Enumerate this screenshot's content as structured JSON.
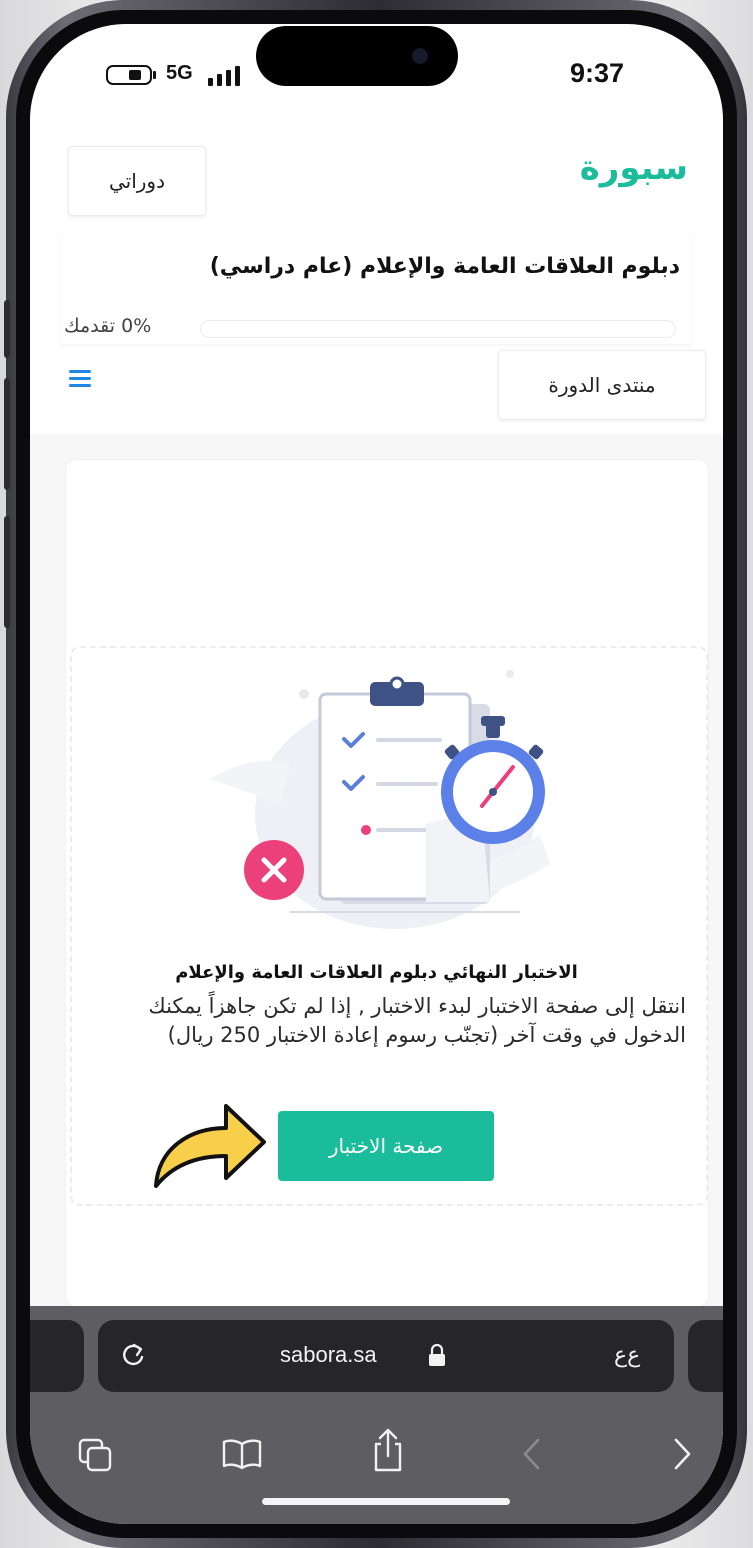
{
  "status_bar": {
    "network": "5G",
    "time": "9:37"
  },
  "header": {
    "logo": "سبورة",
    "my_courses_button": "دوراتي"
  },
  "course": {
    "title": "دبلوم العلاقات العامة والإعلام (عام دراسي)",
    "progress_label": "0% تقدمك",
    "progress_value": 0,
    "forum_button": "منتدى الدورة"
  },
  "quiz": {
    "title": "الاختبار النهائي دبلوم العلاقات العامة والإعلام",
    "description": "انتقل إلى صفحة الاختبار لبدء الاختبار , إذا لم تكن جاهزاً يمكنك الدخول في وقت آخر (تجنّب رسوم إعادة الاختبار 250 ريال)",
    "start_button": "صفحة الاختبار"
  },
  "browser": {
    "url": "sabora.sa",
    "reader_label": "ﻉﻉ"
  },
  "colors": {
    "brand": "#1bbc9b",
    "menu_icon": "#1e88e5",
    "arrow": "#f7cf4a"
  }
}
